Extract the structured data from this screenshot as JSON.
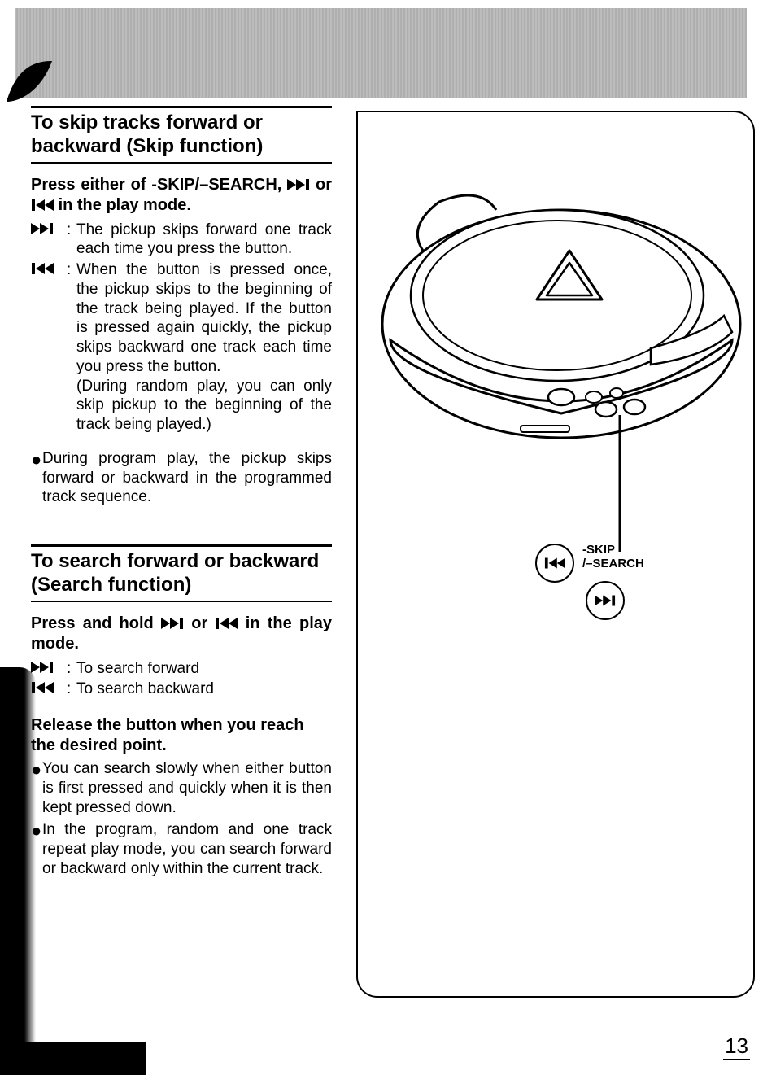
{
  "section1": {
    "title": "To skip tracks forward or backward (Skip function)",
    "sub_before": "Press either of -SKIP/–SEARCH, ",
    "sub_mid": " or ",
    "sub_after": " in the play mode.",
    "fwd_desc": "The pickup skips forward one track each time you press the button.",
    "bwd_desc": "When the button is pressed once, the pickup skips to the beginning of the track being played. If the button is pressed again quickly, the pickup skips backward one track each time you press the button.",
    "bwd_note": "(During random play, you can only skip pickup to the beginning of the track being played.)",
    "bullet": "During program play, the pickup skips forward or backward in the programmed track sequence."
  },
  "section2": {
    "title": "To search forward or backward (Search function)",
    "sub_before": "Press and hold ",
    "sub_mid": " or ",
    "sub_after": " in the play mode.",
    "fwd_desc": "To search forward",
    "bwd_desc": "To search backward",
    "release": "Release the button when you reach the desired point.",
    "bullet1": "You can search slowly when either button is first pressed and quickly when it is then kept pressed down.",
    "bullet2": "In the program, random and one track repeat play mode, you can search forward or backward only within the current track."
  },
  "figure": {
    "label_line1": "-SKIP",
    "label_line2": "/–SEARCH"
  },
  "page_number": "13"
}
